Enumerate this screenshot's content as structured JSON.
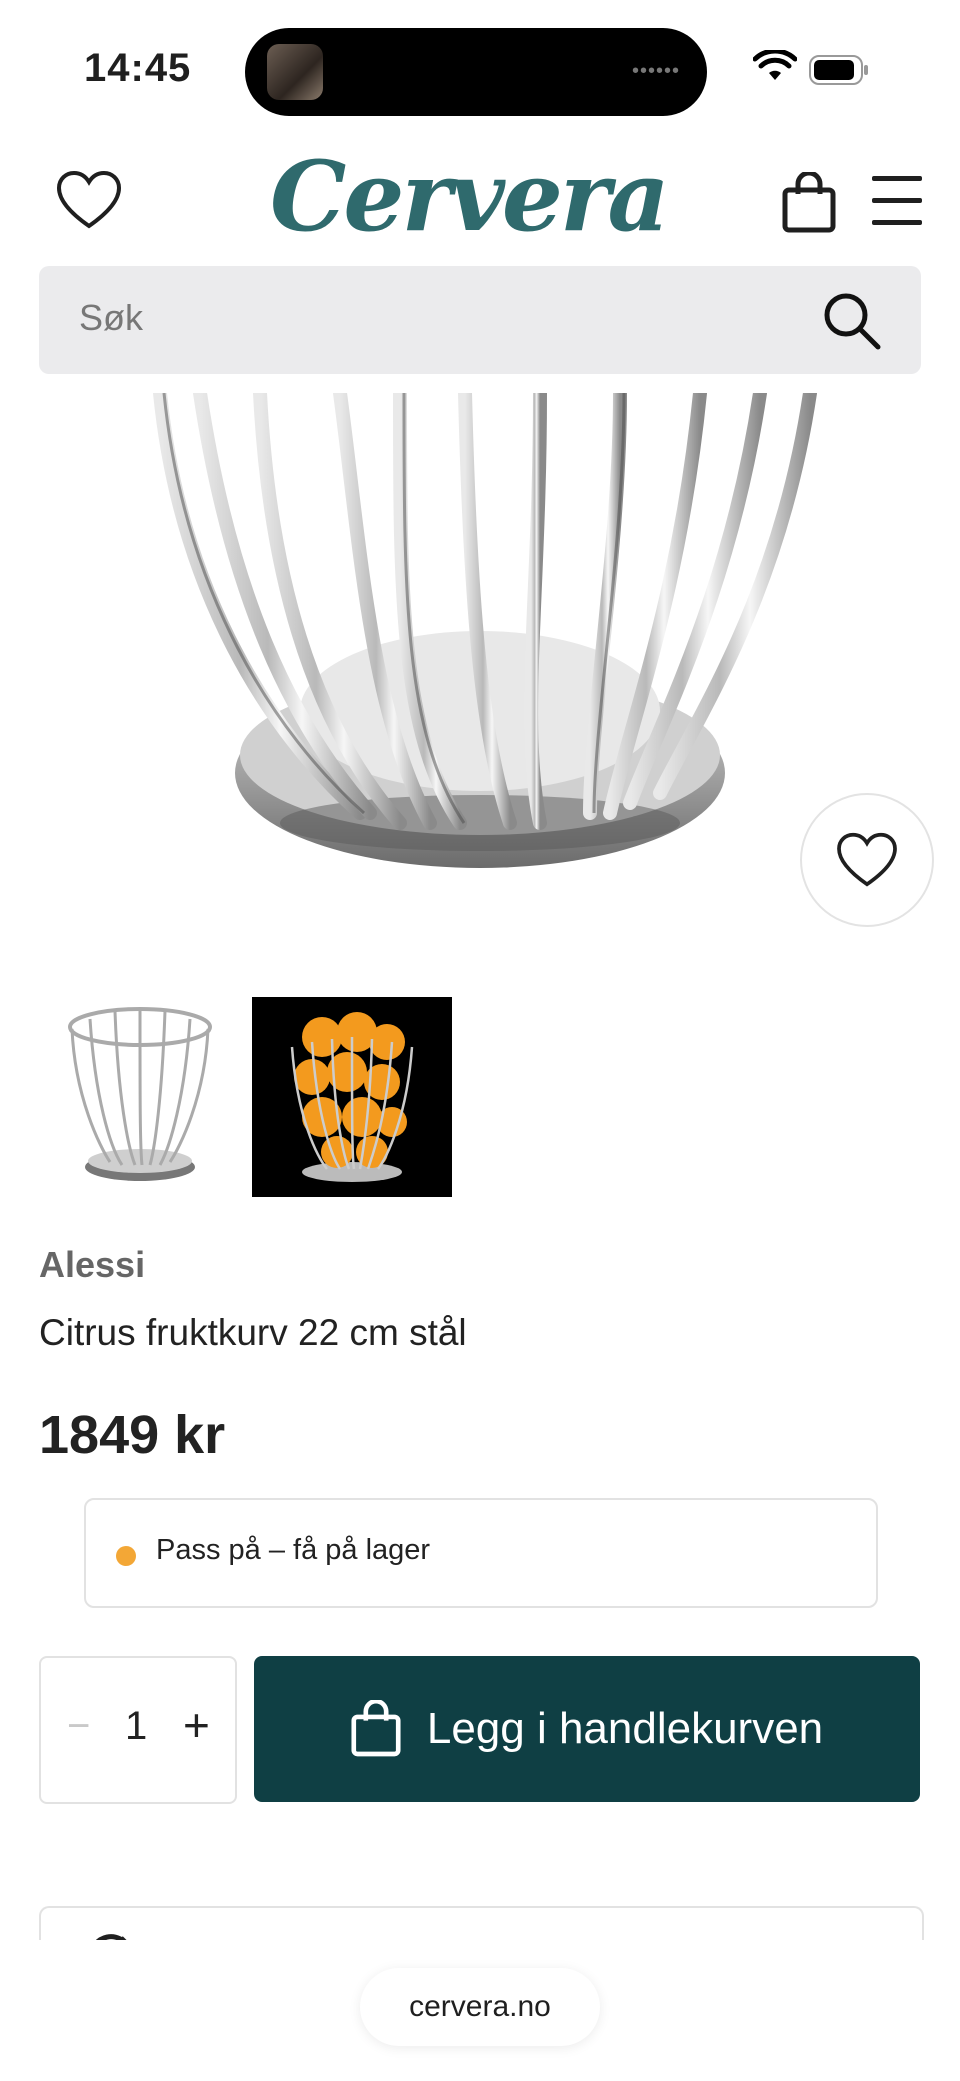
{
  "status_bar": {
    "time": "14:45"
  },
  "header": {
    "logo": "Cervera"
  },
  "search": {
    "placeholder": "Søk"
  },
  "product": {
    "brand": "Alessi",
    "title": "Citrus fruktkurv 22 cm stål",
    "price": "1849 kr",
    "stock_status": "Pass på – få på lager",
    "stock_color": "#f3a736"
  },
  "cart": {
    "quantity": "1",
    "minus": "−",
    "plus": "+",
    "add_label": "Legg i handlekurven",
    "button_color": "#0f3f44"
  },
  "browser": {
    "url": "cervera.no"
  }
}
